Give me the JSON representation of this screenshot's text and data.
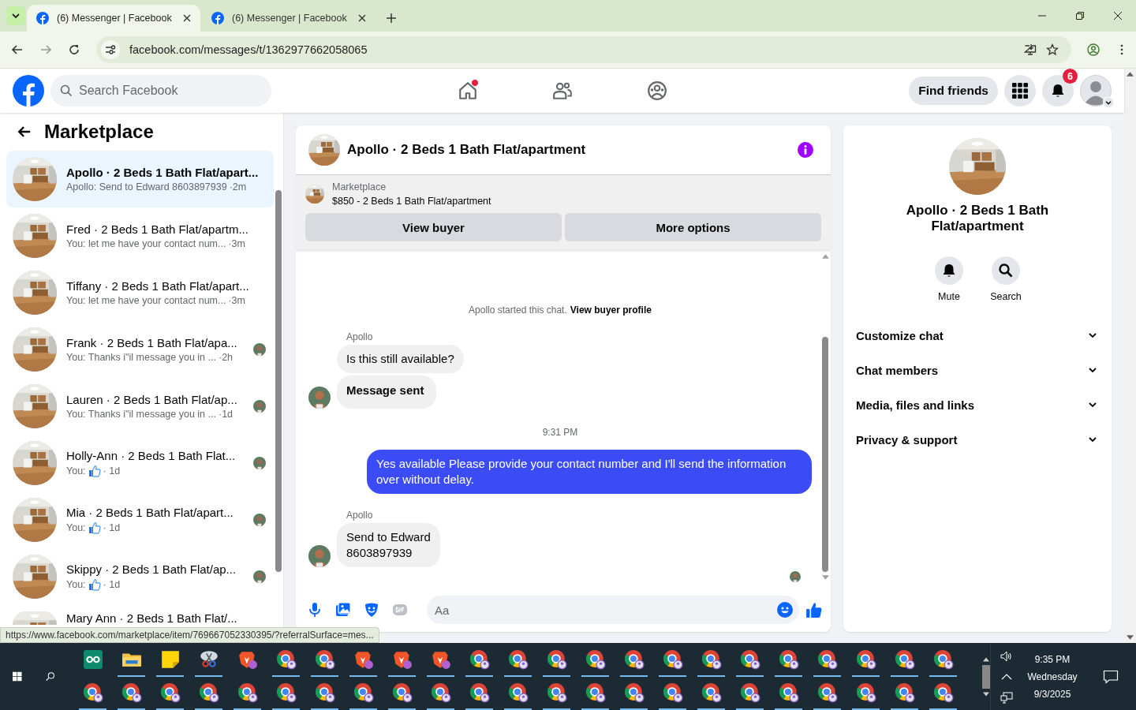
{
  "browser": {
    "tabs": [
      {
        "title": "(6) Messenger | Facebook",
        "selected": true
      },
      {
        "title": "(6) Messenger | Facebook",
        "selected": false
      }
    ],
    "url": "facebook.com/messages/t/1362977662058065"
  },
  "header": {
    "search": {
      "placeholder": "Search Facebook"
    },
    "nav": [
      {
        "kind": "home",
        "dot": true
      },
      {
        "kind": "friends",
        "dot": false
      },
      {
        "kind": "groups",
        "dot": false
      }
    ],
    "find_friends": "Find friends",
    "notifications": "6"
  },
  "sidebar": {
    "title": "Marketplace",
    "items": [
      {
        "name": "Apollo · 2 Beds 1 Bath Flat/apart...",
        "preview": "Apollo: Send to Edward 8603897939",
        "like": false,
        "time": "·2m",
        "selected": true,
        "unread": true,
        "seen": false
      },
      {
        "name": "Fred · 2 Beds 1 Bath Flat/apartm...",
        "preview": "You: let me have your contact num...",
        "like": false,
        "time": "·3m",
        "selected": false,
        "unread": false,
        "seen": false
      },
      {
        "name": "Tiffany · 2 Beds 1 Bath Flat/apart...",
        "preview": "You: let me have your contact num...",
        "like": false,
        "time": "·3m",
        "selected": false,
        "unread": false,
        "seen": false
      },
      {
        "name": "Frank · 2 Beds 1 Bath Flat/apa...",
        "preview": "You: Thanks i\"il message you in ...",
        "like": false,
        "time": "·2h",
        "selected": false,
        "unread": false,
        "seen": true
      },
      {
        "name": "Lauren · 2 Beds 1 Bath Flat/ap...",
        "preview": "You: Thanks i\"il message you in ...",
        "like": false,
        "time": "·1d",
        "selected": false,
        "unread": false,
        "seen": true
      },
      {
        "name": "Holly-Ann · 2 Beds 1 Bath Flat...",
        "preview": "You:",
        "like": true,
        "time": "· 1d",
        "selected": false,
        "unread": false,
        "seen": true
      },
      {
        "name": "Mia · 2 Beds 1 Bath Flat/apart...",
        "preview": "You:",
        "like": true,
        "time": "· 1d",
        "selected": false,
        "unread": false,
        "seen": true
      },
      {
        "name": "Skippy · 2 Beds 1 Bath Flat/ap...",
        "preview": "You:",
        "like": true,
        "time": "· 1d",
        "selected": false,
        "unread": false,
        "seen": true
      },
      {
        "name": "Mary Ann · 2 Beds 1 Bath Flat/...",
        "selected": false,
        "unread": false,
        "seen": false
      }
    ]
  },
  "chat": {
    "title": "Apollo · 2 Beds 1 Bath Flat/apartment",
    "banner": {
      "label": "Marketplace",
      "listing": "$850 - 2 Beds 1 Bath Flat/apartment",
      "buttons": [
        "View buyer",
        "More options"
      ]
    },
    "started": "Apollo started this chat.",
    "profile_link": "View buyer profile",
    "messages": [
      {
        "kind": "sender",
        "text": "Apollo"
      },
      {
        "kind": "in",
        "text": "Is this still available?",
        "bold": false,
        "avatar": false
      },
      {
        "kind": "in",
        "text": "Message sent",
        "bold": true,
        "avatar": true
      },
      {
        "kind": "time",
        "text": "9:31 PM"
      },
      {
        "kind": "out",
        "text": "Yes available Please provide your contact number and I'll send the information over without delay."
      },
      {
        "kind": "sender",
        "text": "Apollo"
      },
      {
        "kind": "in",
        "text": "Send to Edward\n8603897939",
        "bold": false,
        "avatar": true
      }
    ],
    "composer": {
      "placeholder": "Aa"
    }
  },
  "details": {
    "title": "Apollo · 2 Beds 1 Bath Flat/apartment",
    "actions": [
      {
        "kind": "mute",
        "label": "Mute"
      },
      {
        "kind": "search",
        "label": "Search"
      }
    ],
    "sections": [
      {
        "label": "Customize chat",
        "expanded": false
      },
      {
        "label": "Chat members",
        "expanded": false
      },
      {
        "label": "Media, files and links",
        "expanded": false
      },
      {
        "label": "Privacy & support",
        "expanded": false
      }
    ]
  },
  "status_url": "https://www.facebook.com/marketplace/item/769667052330395/?referralSurface=mes...",
  "taskbar": {
    "apps": [
      {
        "kind": "assist",
        "running": false
      },
      {
        "kind": "folder",
        "running": true
      },
      {
        "kind": "note",
        "running": true
      },
      {
        "kind": "snip",
        "running": true
      },
      {
        "kind": "brave",
        "running": false
      },
      {
        "kind": "chrome",
        "running": true
      },
      {
        "kind": "chrome",
        "running": true
      },
      {
        "kind": "brave",
        "running": true
      },
      {
        "kind": "brave",
        "running": true
      },
      {
        "kind": "brave",
        "running": true
      },
      {
        "kind": "chrome",
        "running": true
      },
      {
        "kind": "chrome",
        "running": true
      },
      {
        "kind": "chrome",
        "running": true
      },
      {
        "kind": "chrome",
        "running": true
      },
      {
        "kind": "chrome",
        "running": true
      },
      {
        "kind": "chrome",
        "running": true
      },
      {
        "kind": "chrome",
        "running": true
      },
      {
        "kind": "chrome",
        "running": true
      },
      {
        "kind": "chrome",
        "running": true
      },
      {
        "kind": "chrome",
        "running": true
      },
      {
        "kind": "chrome",
        "running": true
      },
      {
        "kind": "chrome",
        "running": true
      },
      {
        "kind": "chrome",
        "running": true
      },
      {
        "kind": "chrome",
        "running": true
      },
      {
        "kind": "chrome",
        "running": true
      },
      {
        "kind": "chrome",
        "running": true
      },
      {
        "kind": "chrome",
        "running": true
      },
      {
        "kind": "chrome",
        "running": true
      },
      {
        "kind": "chrome",
        "running": true
      },
      {
        "kind": "chrome",
        "running": true
      },
      {
        "kind": "chrome",
        "running": true
      },
      {
        "kind": "chrome",
        "running": true
      },
      {
        "kind": "chrome",
        "running": true
      },
      {
        "kind": "chrome",
        "running": true
      },
      {
        "kind": "chrome",
        "running": true
      },
      {
        "kind": "chrome",
        "running": true
      },
      {
        "kind": "chrome",
        "running": true
      },
      {
        "kind": "chrome",
        "running": true
      },
      {
        "kind": "chrome",
        "running": true
      },
      {
        "kind": "chrome",
        "running": true
      },
      {
        "kind": "chrome",
        "running": true
      },
      {
        "kind": "chrome",
        "running": true
      },
      {
        "kind": "chrome",
        "running": true
      },
      {
        "kind": "chrome",
        "running": true
      },
      {
        "kind": "chrome",
        "running": true
      },
      {
        "kind": "chrome",
        "running": true
      }
    ],
    "time": "9:35 PM",
    "day": "Wednesday",
    "date": "9/3/2025"
  }
}
